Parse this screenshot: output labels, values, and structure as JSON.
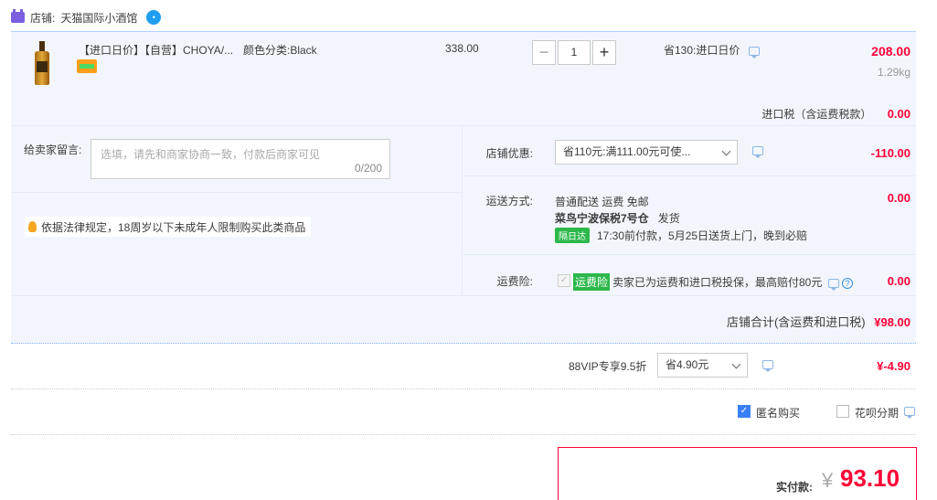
{
  "shop": {
    "label": "店铺:",
    "name": "天猫国际小酒馆"
  },
  "item": {
    "title": "【进口日价】【自营】CHOYA/...",
    "sku": "颜色分类:Black",
    "unit_price": "338.00",
    "quantity": "1",
    "qty_minus": "−",
    "qty_plus": "+",
    "promo": "省130:进口日价",
    "total": "208.00",
    "weight": "1.29kg"
  },
  "import_tax": {
    "label": "进口税（含运费税款）",
    "value": "0.00"
  },
  "memo": {
    "label": "给卖家留言:",
    "placeholder": "选填，请先和商家协商一致，付款后商家可见",
    "count": "0/200"
  },
  "legal_note": "依据法律规定，18周岁以下未成年人限制购买此类商品",
  "shop_coupon": {
    "label": "店铺优惠:",
    "selected": "省110元:满111.00元可使...",
    "value": "-110.00"
  },
  "shipping": {
    "label": "运送方式:",
    "method": "普通配送 运费 免邮",
    "warehouse": "菜鸟宁波保税7号仓",
    "dispatch": "发货",
    "badge": "隔日达",
    "promise": "17:30前付款，5月25日送货上门，晚到必赔",
    "value": "0.00"
  },
  "insurance": {
    "label": "运费险:",
    "badge": "运费险",
    "text": "卖家已为运费和进口税投保，最高赔付80元",
    "value": "0.00"
  },
  "shop_total": {
    "label": "店铺合计(含运费和进口税)",
    "value": "¥98.00"
  },
  "vip": {
    "label": "88VIP专享9.5折",
    "selected": "省4.90元",
    "value": "¥-4.90"
  },
  "options": {
    "anonymous": "匿名购买",
    "installment": "花呗分期"
  },
  "payment": {
    "label": "实付款:",
    "currency": "¥",
    "value": "93.10"
  },
  "colors": {
    "accent": "#ff0036",
    "panel": "#f2f6fc",
    "badge_green": "#2cb84b"
  }
}
